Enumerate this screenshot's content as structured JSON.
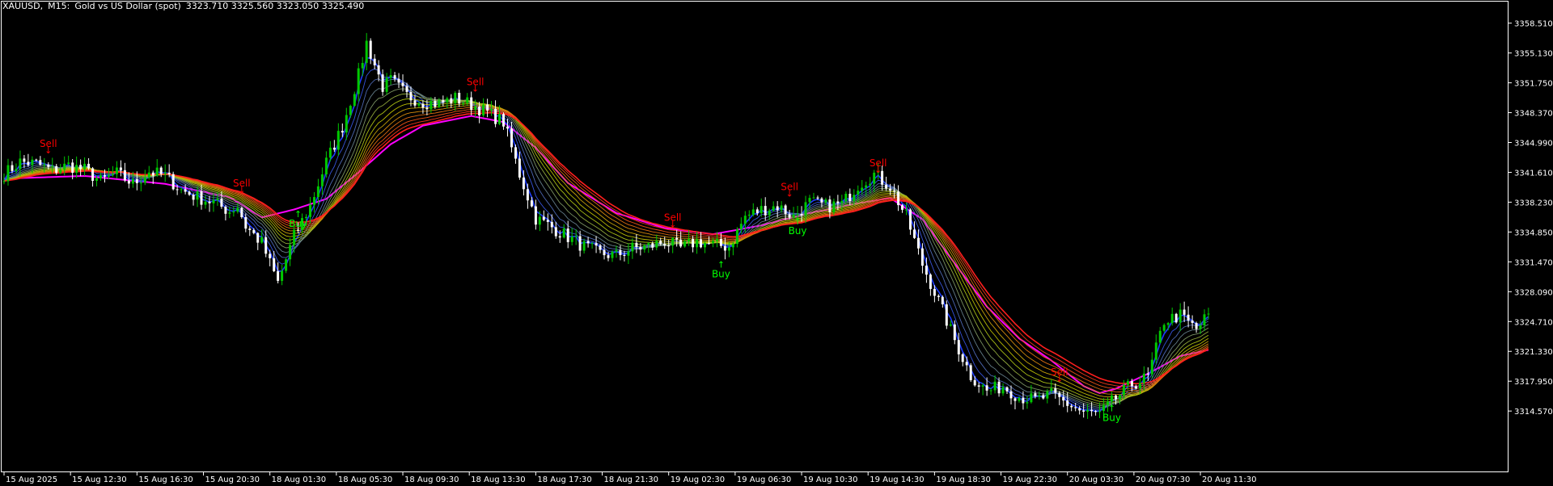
{
  "header": {
    "symbol": "XAUUSD,",
    "timeframe": "M15:",
    "description": "Gold vs US Dollar (spot)",
    "ohlc": "3323.710 3325.560 3323.050 3325.490"
  },
  "colors": {
    "background": "#000000",
    "frame": "#ffffff",
    "bull": "#00c800",
    "bear": "#ffffff",
    "ribbon_fast": "#1e3cff",
    "ribbon_mid": "#b4c800",
    "ribbon_slow": "#ff1e1e",
    "long_ma": "#ff00ff",
    "sell": "#ff0000",
    "buy": "#00ff00",
    "axis_text": "#ffffff"
  },
  "chart_data": {
    "type": "candlestick",
    "symbol": "XAUUSD",
    "timeframe": "M15",
    "grid": false,
    "ylim": [
      3311.2,
      3360.4
    ],
    "y_ticks": [
      "3358.510",
      "3355.130",
      "3351.750",
      "3348.370",
      "3344.990",
      "3341.610",
      "3338.230",
      "3334.850",
      "3331.470",
      "3328.090",
      "3324.710",
      "3321.330",
      "3317.950",
      "3314.570"
    ],
    "x_ticks": [
      "15 Aug 2025",
      "15 Aug 12:30",
      "15 Aug 16:30",
      "15 Aug 20:30",
      "18 Aug 01:30",
      "18 Aug 05:30",
      "18 Aug 09:30",
      "18 Aug 13:30",
      "18 Aug 17:30",
      "18 Aug 21:30",
      "19 Aug 02:30",
      "19 Aug 06:30",
      "19 Aug 10:30",
      "19 Aug 14:30",
      "19 Aug 18:30",
      "19 Aug 22:30",
      "20 Aug 03:30",
      "20 Aug 07:30",
      "20 Aug 11:30"
    ],
    "price_path": [
      [
        0,
        3341.4
      ],
      [
        4,
        3342.8
      ],
      [
        8,
        3342.6
      ],
      [
        12,
        3341.8
      ],
      [
        16,
        3342.4
      ],
      [
        20,
        3341.9
      ],
      [
        24,
        3340.6
      ],
      [
        28,
        3341.5
      ],
      [
        32,
        3340.3
      ],
      [
        36,
        3341.7
      ],
      [
        40,
        3341.2
      ],
      [
        44,
        3339.6
      ],
      [
        48,
        3338.8
      ],
      [
        52,
        3338.2
      ],
      [
        56,
        3337.2
      ],
      [
        58,
        3337.8
      ],
      [
        60,
        3335.5
      ],
      [
        64,
        3333.6
      ],
      [
        66,
        3331.3
      ],
      [
        68,
        3329.1
      ],
      [
        72,
        3334.4
      ],
      [
        76,
        3337.8
      ],
      [
        80,
        3342.8
      ],
      [
        84,
        3346.8
      ],
      [
        88,
        3352.6
      ],
      [
        90,
        3356.3
      ],
      [
        94,
        3351.3
      ],
      [
        96,
        3352.0
      ],
      [
        100,
        3350.3
      ],
      [
        104,
        3349.6
      ],
      [
        108,
        3349.4
      ],
      [
        112,
        3350.0
      ],
      [
        116,
        3349.3
      ],
      [
        120,
        3348.4
      ],
      [
        124,
        3347.3
      ],
      [
        128,
        3341.4
      ],
      [
        132,
        3336.4
      ],
      [
        136,
        3335.4
      ],
      [
        140,
        3334.3
      ],
      [
        144,
        3333.2
      ],
      [
        148,
        3332.4
      ],
      [
        152,
        3332.2
      ],
      [
        156,
        3333.0
      ],
      [
        160,
        3333.2
      ],
      [
        164,
        3333.8
      ],
      [
        168,
        3333.0
      ],
      [
        172,
        3333.8
      ],
      [
        176,
        3333.4
      ],
      [
        180,
        3333.2
      ],
      [
        184,
        3336.6
      ],
      [
        188,
        3337.4
      ],
      [
        192,
        3337.8
      ],
      [
        196,
        3336.6
      ],
      [
        200,
        3338.2
      ],
      [
        204,
        3337.8
      ],
      [
        208,
        3338.0
      ],
      [
        212,
        3340.2
      ],
      [
        216,
        3341.4
      ],
      [
        220,
        3340.0
      ],
      [
        224,
        3336.6
      ],
      [
        228,
        3331.2
      ],
      [
        232,
        3327.0
      ],
      [
        236,
        3322.6
      ],
      [
        240,
        3318.6
      ],
      [
        244,
        3316.8
      ],
      [
        248,
        3317.4
      ],
      [
        252,
        3316.2
      ],
      [
        256,
        3315.8
      ],
      [
        260,
        3316.4
      ],
      [
        264,
        3315.4
      ],
      [
        268,
        3314.4
      ],
      [
        272,
        3314.2
      ],
      [
        276,
        3316.0
      ],
      [
        280,
        3317.6
      ],
      [
        284,
        3318.4
      ],
      [
        288,
        3324.8
      ],
      [
        292,
        3325.4
      ],
      [
        296,
        3323.8
      ],
      [
        299,
        3325.5
      ]
    ],
    "long_ma_path": [
      [
        0,
        3340.9
      ],
      [
        20,
        3341.2
      ],
      [
        40,
        3340.3
      ],
      [
        56,
        3338.8
      ],
      [
        64,
        3336.5
      ],
      [
        72,
        3337.4
      ],
      [
        80,
        3338.6
      ],
      [
        88,
        3341.6
      ],
      [
        96,
        3344.8
      ],
      [
        104,
        3346.9
      ],
      [
        116,
        3348.0
      ],
      [
        124,
        3347.3
      ],
      [
        132,
        3344.4
      ],
      [
        140,
        3340.4
      ],
      [
        152,
        3337.0
      ],
      [
        164,
        3335.3
      ],
      [
        176,
        3334.6
      ],
      [
        188,
        3335.6
      ],
      [
        200,
        3337.0
      ],
      [
        212,
        3338.1
      ],
      [
        220,
        3338.7
      ],
      [
        228,
        3336.3
      ],
      [
        236,
        3331.3
      ],
      [
        244,
        3326.4
      ],
      [
        252,
        3322.8
      ],
      [
        260,
        3320.3
      ],
      [
        268,
        3317.4
      ],
      [
        272,
        3316.6
      ],
      [
        276,
        3317.1
      ],
      [
        284,
        3318.8
      ],
      [
        292,
        3320.8
      ],
      [
        299,
        3321.5
      ]
    ],
    "ribbon_lines": 14,
    "signals": [
      {
        "label": "Sell",
        "bar": 11,
        "price": 3343.4
      },
      {
        "label": "Sell",
        "bar": 59,
        "price": 3338.9
      },
      {
        "label": "Buy",
        "bar": 73,
        "price": 3337.8
      },
      {
        "label": "Sell",
        "bar": 117,
        "price": 3350.4
      },
      {
        "label": "Sell",
        "bar": 166,
        "price": 3335.0
      },
      {
        "label": "Buy",
        "bar": 178,
        "price": 3332.1
      },
      {
        "label": "Sell",
        "bar": 195,
        "price": 3338.5
      },
      {
        "label": "Buy",
        "bar": 197,
        "price": 3337.0
      },
      {
        "label": "Sell",
        "bar": 217,
        "price": 3341.2
      },
      {
        "label": "Sell",
        "bar": 262,
        "price": 3317.5
      },
      {
        "label": "Buy",
        "bar": 275,
        "price": 3315.8
      }
    ]
  }
}
